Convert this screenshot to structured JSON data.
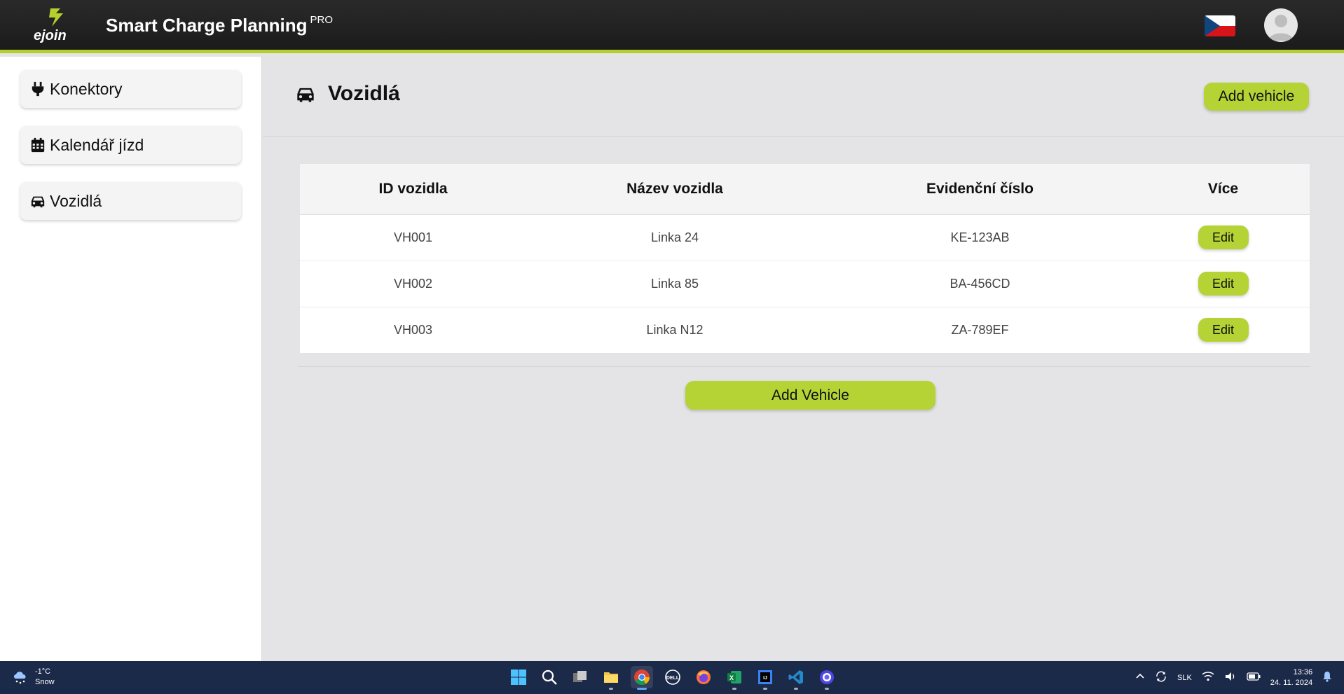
{
  "header": {
    "logo_text": "ejoin",
    "app_title": "Smart Charge Planning",
    "app_badge": "PRO",
    "language_flag": "czech-flag",
    "avatar": "user-avatar-icon"
  },
  "sidebar": {
    "items": [
      {
        "label": "Konektory",
        "icon": "plug-icon"
      },
      {
        "label": "Kalendář jízd",
        "icon": "calendar-icon"
      },
      {
        "label": "Vozidlá",
        "icon": "car-icon"
      }
    ]
  },
  "page": {
    "title": "Vozidlá",
    "title_icon": "car-icon",
    "add_top_label": "Add vehicle",
    "add_bottom_label": "Add Vehicle"
  },
  "table": {
    "columns": [
      "ID vozidla",
      "Název vozidla",
      "Evidenční číslo",
      "Více"
    ],
    "rows": [
      {
        "id": "VH001",
        "name": "Linka 24",
        "plate": "KE-123AB",
        "action": "Edit"
      },
      {
        "id": "VH002",
        "name": "Linka 85",
        "plate": "BA-456CD",
        "action": "Edit"
      },
      {
        "id": "VH003",
        "name": "Linka N12",
        "plate": "ZA-789EF",
        "action": "Edit"
      }
    ]
  },
  "taskbar": {
    "weather_temp": "-1°C",
    "weather_desc": "Snow",
    "keyboard": "SLK",
    "time": "13:36",
    "date": "24. 11. 2024"
  },
  "colors": {
    "accent": "#b5d334",
    "header_bg": "#1b1b1b",
    "taskbar_bg": "#1c2a4a"
  }
}
